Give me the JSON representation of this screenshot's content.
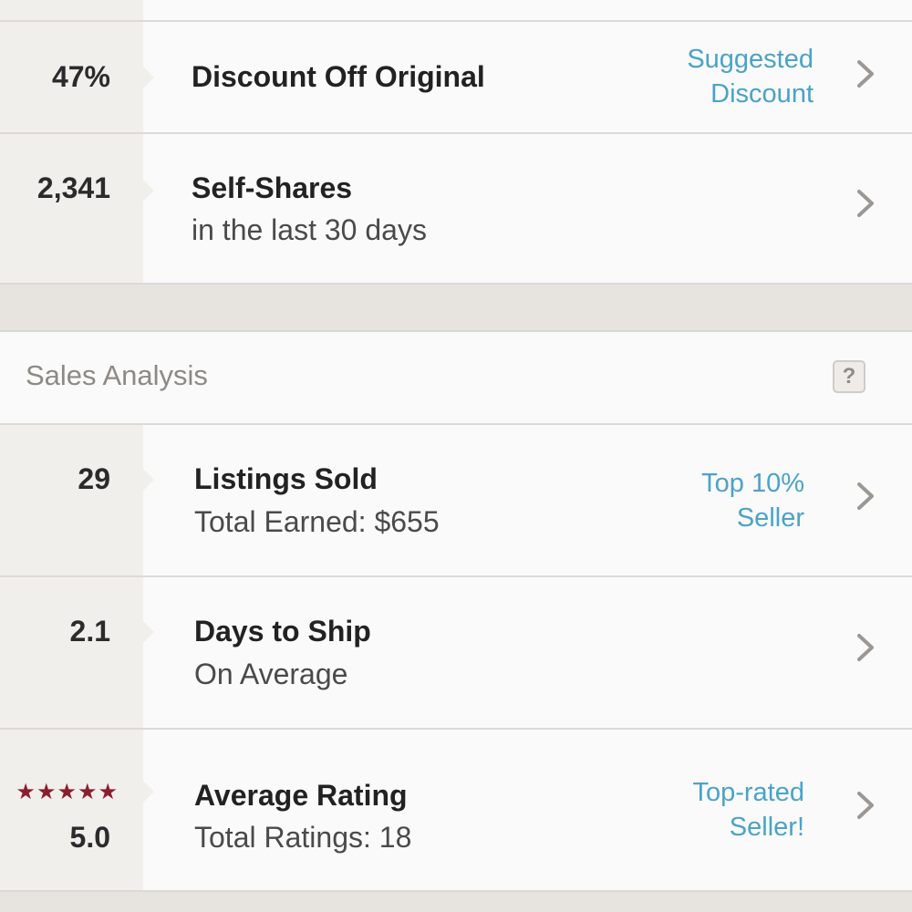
{
  "top_section": {
    "rows": [
      {
        "value": "47%",
        "title": "Discount Off Original",
        "subtitle": "",
        "badge_line1": "Suggested",
        "badge_line2": "Discount"
      },
      {
        "value": "2,341",
        "title": "Self-Shares",
        "subtitle": "in the last 30 days",
        "badge_line1": "",
        "badge_line2": ""
      }
    ]
  },
  "sales_analysis": {
    "title": "Sales Analysis",
    "help_label": "?",
    "rows": [
      {
        "value": "29",
        "title": "Listings Sold",
        "subtitle": "Total Earned: $655",
        "badge_line1": "Top 10%",
        "badge_line2": "Seller"
      },
      {
        "value": "2.1",
        "title": "Days to Ship",
        "subtitle": "On Average",
        "badge_line1": "",
        "badge_line2": ""
      },
      {
        "value": "5.0",
        "title": "Average Rating",
        "subtitle": "Total Ratings: 18",
        "badge_line1": "Top-rated",
        "badge_line2": "Seller!",
        "stars": "★★★★★",
        "rating": 5.0,
        "star_color": "#8b1e2c"
      }
    ]
  },
  "colors": {
    "accent_link": "#4aa3c9",
    "metric_column": "#f1efec",
    "background": "#e9e6e2"
  },
  "icons": {
    "row_arrow": "chevron-right-icon",
    "help": "question-mark-icon",
    "rating": "star-icon"
  }
}
